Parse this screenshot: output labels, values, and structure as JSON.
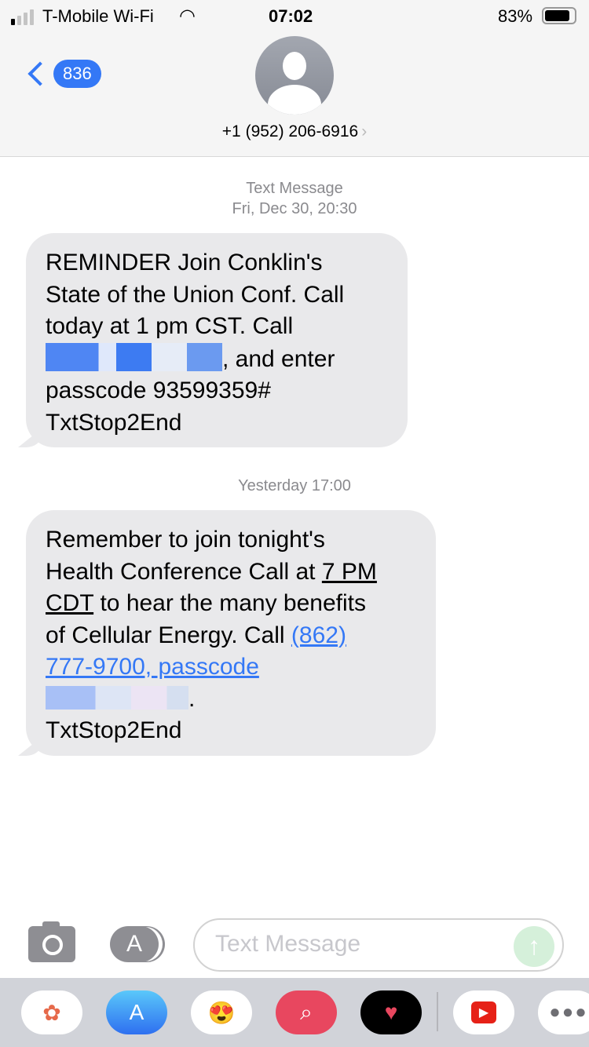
{
  "status_bar": {
    "carrier": "T-Mobile Wi-Fi",
    "time": "07:02",
    "battery": "83%",
    "signal_bars_active": 1,
    "signal_bars_total": 4
  },
  "header": {
    "back_count": "836",
    "contact": "+1 (952) 206-6916"
  },
  "messages": [
    {
      "meta1": "Text Message",
      "meta2": "Fri, Dec 30, 20:30",
      "lines": [
        "REMINDER Join Conklin's",
        "State of the Union Conf. Call",
        "today at 1 pm CST. Call",
        ", and enter",
        "passcode 93599359#",
        "TxtStop2End"
      ]
    },
    {
      "meta": "Yesterday 17:00",
      "l1": "Remember to join tonight's",
      "l2a": "Health Conference Call at ",
      "l2b": "7 PM",
      "l3a": "CDT",
      "l3b": " to hear the many benefits",
      "l4a": "of Cellular Energy. Call ",
      "l4b": "(862)",
      "l5": "777-9700, passcode",
      "l6": ".",
      "l7": "TxtStop2End"
    }
  ],
  "composer": {
    "placeholder": "Text Message"
  },
  "app_drawer": [
    "Photos",
    "App Store",
    "Memoji",
    "Web Search",
    "Heart app",
    "YouTube",
    "More"
  ],
  "colors": {
    "accent": "#3478f6",
    "bubble": "#e9e9eb"
  }
}
